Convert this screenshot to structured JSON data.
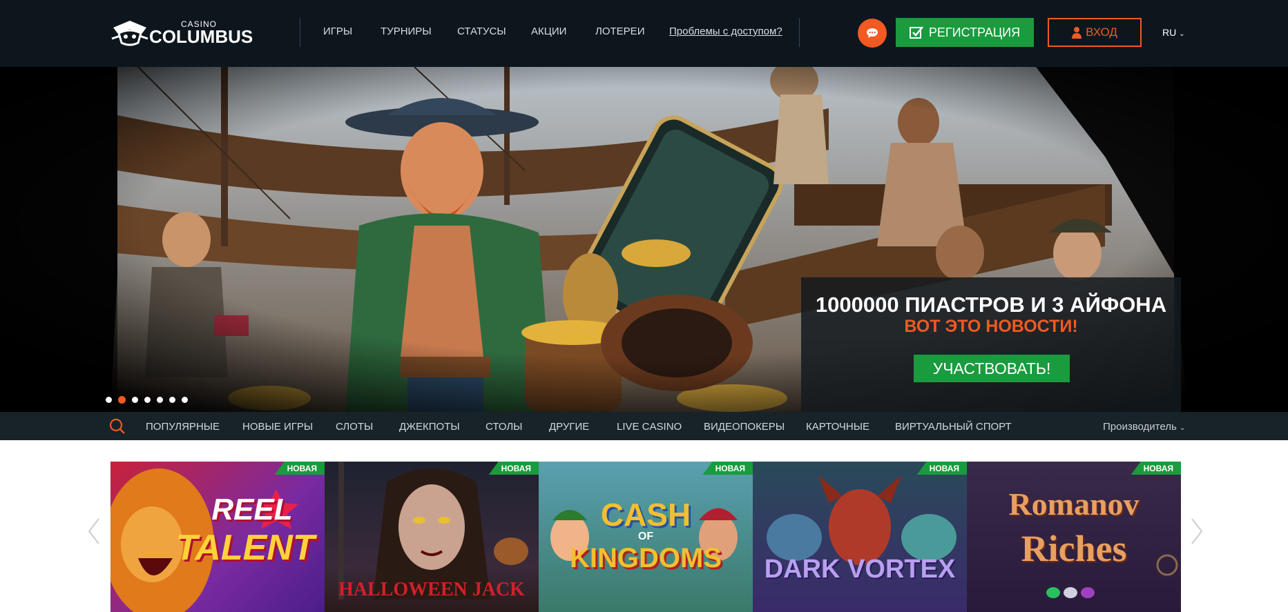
{
  "header": {
    "logo": {
      "small": "CASINO",
      "brand": "COLUMBUS"
    },
    "nav": [
      "ИГРЫ",
      "ТУРНИРЫ",
      "СТАТУСЫ",
      "АКЦИИ",
      "ЛОТЕРЕИ"
    ],
    "access_link": "Проблемы с доступом?",
    "chat_icon": "chat-bubble-icon",
    "register_label": "РЕГИСТРАЦИЯ",
    "login_label": "ВХОД",
    "language": "RU",
    "colors": {
      "accent": "#f15a22",
      "green": "#1a9b3e",
      "bg": "#0e161d"
    }
  },
  "hero": {
    "title": "1000000 ПИАСТРОВ И 3 АЙФОНА",
    "subtitle": "ВОТ ЭТО НОВОСТИ!",
    "cta": "УЧАСТВОВАТЬ!",
    "slides_count": 7,
    "active_slide": 2
  },
  "categories": {
    "items": [
      "ПОПУЛЯРНЫЕ",
      "НОВЫЕ ИГРЫ",
      "СЛОТЫ",
      "ДЖЕКПОТЫ",
      "СТОЛЫ",
      "ДРУГИЕ",
      "LIVE CASINO",
      "ВИДЕОПОКЕРЫ",
      "КАРТОЧНЫЕ",
      "ВИРТУАЛЬНЫЙ СПОРТ"
    ],
    "provider_label": "Производитель"
  },
  "games": {
    "badge": "НОВАЯ",
    "tiles": [
      {
        "line1": "REEL",
        "line2": "TALENT"
      },
      {
        "line1": "HALLOWEEN",
        "line2": "JACK"
      },
      {
        "line1": "CASH",
        "line2": "KINGDOMS",
        "connector": "OF"
      },
      {
        "line1": "DARK",
        "line2": "VORTEX"
      },
      {
        "line1": "Romanov",
        "line2": "Riches"
      }
    ]
  }
}
